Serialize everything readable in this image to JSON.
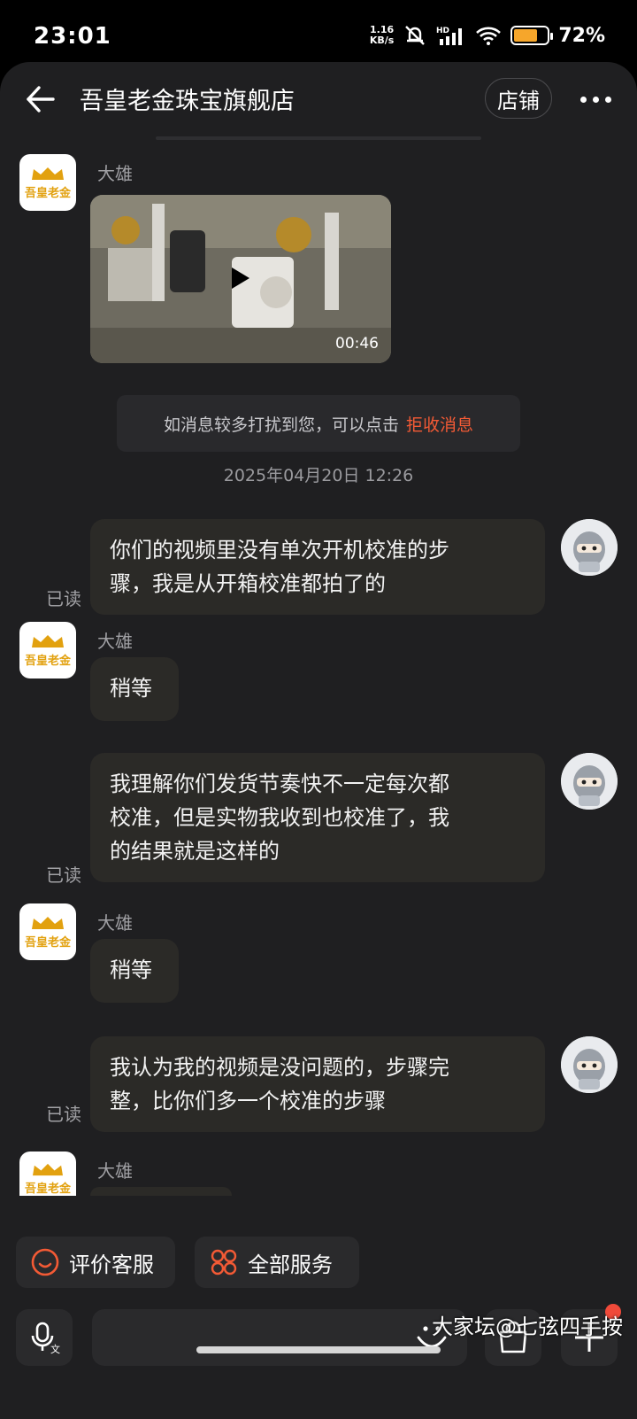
{
  "status": {
    "time": "23:01",
    "netspeed_value": "1.16",
    "netspeed_unit": "KB/s",
    "battery": "72%",
    "battery_level": 0.72
  },
  "header": {
    "title": "吾皇老金珠宝旗舰店",
    "store_label": "店铺"
  },
  "shop_logo_text": "吾皇老金",
  "messages": [
    {
      "sender": "大雄",
      "video_duration": "00:46"
    },
    {
      "text_line1": "你们的视频里没有单次开机校准的步",
      "text_line2": "骤，我是从开箱校准都拍了的",
      "read": "已读"
    },
    {
      "sender": "大雄",
      "text": "稍等"
    },
    {
      "text_line1": "我理解你们发货节奏快不一定每次都",
      "text_line2": "校准，但是实物我收到也校准了，我",
      "text_line3": "的结果就是这样的",
      "read": "已读"
    },
    {
      "sender": "大雄",
      "text": "稍等"
    },
    {
      "text_line1": "我认为我的视频是没问题的，步骤完",
      "text_line2": "整，比你们多一个校准的步骤",
      "read": "已读"
    },
    {
      "sender": "大雄"
    }
  ],
  "system_note": {
    "text": "如消息较多打扰到您，可以点击",
    "link": "拒收消息"
  },
  "timestamp": "2025年04月20日 12:26",
  "quick_actions": [
    {
      "label": "评价客服",
      "icon": "smile-circle-icon"
    },
    {
      "label": "全部服务",
      "icon": "grid-circles-icon"
    }
  ],
  "watermark": "大家坛@七弦四手按",
  "colors": {
    "accent": "#f35a35",
    "logo": "#e2a10f",
    "bubble": "#2b2a27",
    "background": "#1f1f21"
  }
}
